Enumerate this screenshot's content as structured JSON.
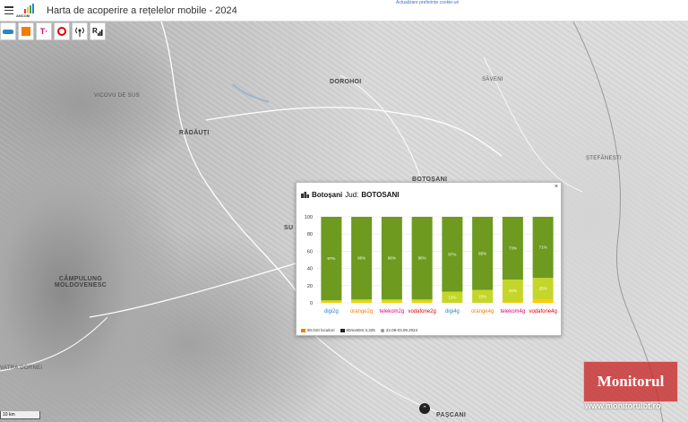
{
  "header": {
    "title": "Harta de acoperire a rețelelor mobile - 2024",
    "logo_text": "ANCOM",
    "preferences_link": "Actualizare preferințe cookie-uri"
  },
  "operators": [
    {
      "name": "digi",
      "color": "#2e86c1"
    },
    {
      "name": "orange",
      "color": "#f57c00"
    },
    {
      "name": "telekom",
      "color": "#e20074"
    },
    {
      "name": "vodafone",
      "color": "#e60000"
    },
    {
      "name": "signal",
      "color": "#111111"
    },
    {
      "name": "R",
      "color": "#111111"
    }
  ],
  "map": {
    "places": [
      {
        "name": "VICOVU DE SUS",
        "cls": "place"
      },
      {
        "name": "DOROHOI",
        "cls": "place big"
      },
      {
        "name": "SĂVENI",
        "cls": "place"
      },
      {
        "name": "RĂDĂUȚI",
        "cls": "place big"
      },
      {
        "name": "ȘTEFĂNEȘTI",
        "cls": "place"
      },
      {
        "name": "BOTOȘANI",
        "cls": "place big"
      },
      {
        "name": "SU",
        "cls": "place big"
      },
      {
        "name": "CÂMPULUNG MOLDOVENESC",
        "cls": "place big"
      },
      {
        "name": "VATRA DORNEI",
        "cls": "place"
      },
      {
        "name": "PAȘCANI",
        "cls": "place big"
      }
    ],
    "scale": "10 km"
  },
  "popup": {
    "close": "×",
    "place": "Botoșani",
    "county_label": "Jud:",
    "county": "BOTOSANI",
    "footer": {
      "localities": "90.010 locuitori",
      "grid": "50mx50m:3.325",
      "period": "22.08-03.09.2024"
    }
  },
  "chart_data": {
    "type": "bar",
    "stacked": true,
    "categories": [
      "digi2g",
      "orange2g",
      "telekom2g",
      "vodafone2g",
      "digi4g",
      "orange4g",
      "telekom4g",
      "vodafone4g"
    ],
    "category_colors": [
      "#2e86c1",
      "#f57c00",
      "#e20074",
      "#e60000",
      "#2e86c1",
      "#f57c00",
      "#e20074",
      "#e60000"
    ],
    "series": [
      {
        "values": [
          1,
          2,
          2,
          2,
          0,
          0,
          1,
          4
        ],
        "color": "#ffcc00"
      },
      {
        "values": [
          2,
          2,
          2,
          2,
          13,
          15,
          26,
          25
        ],
        "color": "#c5d62a"
      },
      {
        "values": [
          97,
          96,
          96,
          96,
          87,
          85,
          73,
          71
        ],
        "color": "#6d9a1f"
      }
    ],
    "labels": [
      [
        "",
        "",
        "",
        "",
        "",
        "",
        "",
        ""
      ],
      [
        "",
        "",
        "",
        "",
        "13%",
        "15%",
        "26%",
        "25%"
      ],
      [
        "97%",
        "96%",
        "96%",
        "96%",
        "87%",
        "85%",
        "73%",
        "71%"
      ]
    ],
    "yticks": [
      0,
      20,
      40,
      60,
      80,
      100
    ],
    "ylim": [
      0,
      100
    ],
    "grid": true
  },
  "watermark": {
    "name": "Monitorul",
    "sub": "de Botoșani",
    "url": "www.monitorulbt.ro"
  }
}
